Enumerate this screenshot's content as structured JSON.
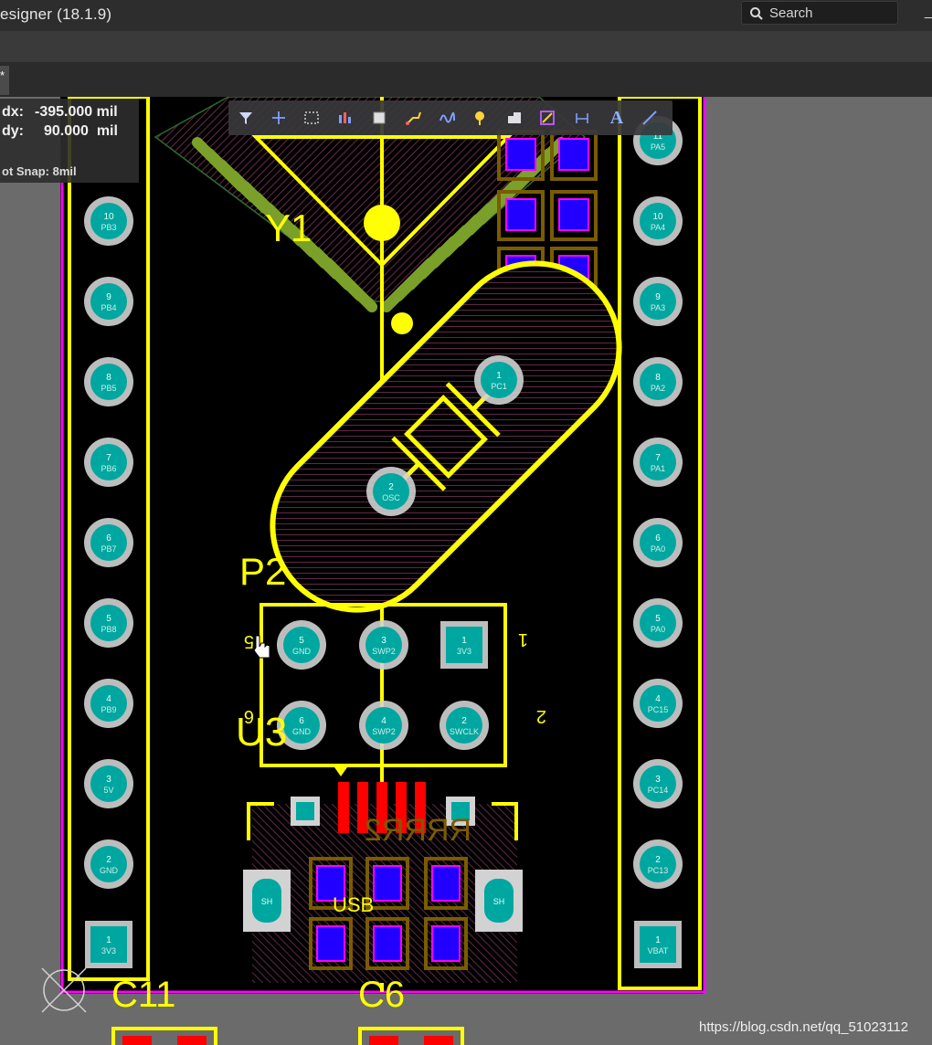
{
  "app": {
    "title": "esigner (18.1.9)",
    "search_placeholder": "Search",
    "doc_tab_label": "*"
  },
  "hud": {
    "dx_label": "dx:",
    "dx_value": "-395.000 mil",
    "dy_label": "dy:",
    "dy_value": "90.000  mil",
    "snap": "ot Snap: 8mil"
  },
  "active_bar": {
    "tools": [
      "filter-icon",
      "add-icon",
      "select-rect-icon",
      "align-icon",
      "component-icon",
      "route-icon",
      "interactive-route-icon",
      "via-icon",
      "polygon-icon",
      "pad-icon",
      "dimension-icon",
      "text-icon",
      "line-icon"
    ],
    "text_tool_glyph": "A"
  },
  "board": {
    "colors": {
      "board_edge": "#ff00ff",
      "silkscreen": "#ffff00",
      "pad_fill": "#00a7a0",
      "pad_ring": "#d2d2d2",
      "top_smd": "#ff0000",
      "mid_layer": "#2200ff",
      "bottom_pad_outline": "#7a5c00"
    },
    "designators": {
      "crystal": "Y1",
      "connector": "P2",
      "u3": "U3",
      "usb": "USB",
      "bottom_left_cap": "C11",
      "bottom_right_cap": "C6"
    },
    "left_header_pins": [
      {
        "num": "10",
        "name": "PB3"
      },
      {
        "num": "9",
        "name": "PB4"
      },
      {
        "num": "8",
        "name": "PB5"
      },
      {
        "num": "7",
        "name": "PB6"
      },
      {
        "num": "6",
        "name": "PB7"
      },
      {
        "num": "5",
        "name": "PB8"
      },
      {
        "num": "4",
        "name": "PB9"
      },
      {
        "num": "3",
        "name": "5V"
      },
      {
        "num": "2",
        "name": "GND"
      },
      {
        "num": "1",
        "name": "3V3"
      }
    ],
    "right_header_pins": [
      {
        "num": "11",
        "name": "PA5"
      },
      {
        "num": "10",
        "name": "PA4"
      },
      {
        "num": "9",
        "name": "PA3"
      },
      {
        "num": "8",
        "name": "PA2"
      },
      {
        "num": "7",
        "name": "PA1"
      },
      {
        "num": "6",
        "name": "PA0"
      },
      {
        "num": "5",
        "name": "PA0"
      },
      {
        "num": "4",
        "name": "PC15"
      },
      {
        "num": "3",
        "name": "PC14"
      },
      {
        "num": "2",
        "name": "PC13"
      },
      {
        "num": "1",
        "name": "VBAT"
      }
    ],
    "crystal_pins": [
      {
        "num": "1",
        "name": "PC1"
      },
      {
        "num": "2",
        "name": "OSC"
      }
    ],
    "p2_pins": [
      {
        "num": "5",
        "name": "GND"
      },
      {
        "num": "3",
        "name": "SWP2"
      },
      {
        "num": "1",
        "name": "3V3"
      },
      {
        "num": "6",
        "name": "GND"
      },
      {
        "num": "4",
        "name": "SWP2"
      },
      {
        "num": "2",
        "name": "SWCLK"
      }
    ],
    "p2_side_labels": {
      "left_top": "5",
      "left_bottom": "6",
      "right_top": "1",
      "right_bottom": "2"
    },
    "usb_pads": [
      {
        "name": "SH"
      },
      {
        "name": "SH"
      }
    ],
    "usb_mirrored_text": "RRRR2"
  },
  "watermark": "https://blog.csdn.net/qq_51023112"
}
